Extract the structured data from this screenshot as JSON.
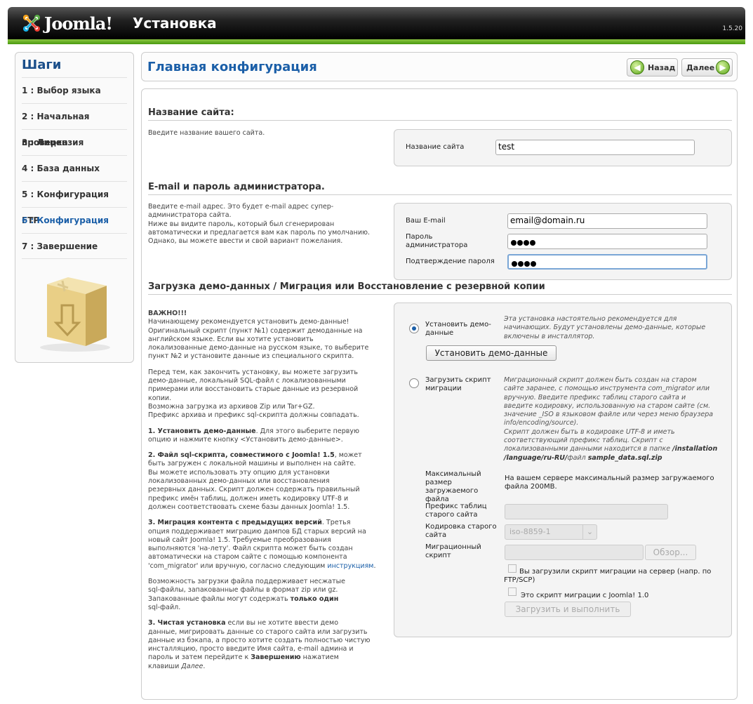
{
  "header": {
    "logo_text": "Joomla!",
    "title": "Установка",
    "version": "1.5.20"
  },
  "steps": {
    "title": "Шаги",
    "items": [
      {
        "label": "1 : Выбор языка"
      },
      {
        "label": "2 : Начальная проверка"
      },
      {
        "label": "3 : Лицензия"
      },
      {
        "label": "4 : База данных"
      },
      {
        "label": "5 : Конфигурация FTP"
      },
      {
        "label": "6 : Конфигурация"
      },
      {
        "label": "7 : Завершение"
      }
    ]
  },
  "page": {
    "title": "Главная конфигурация",
    "back": "Назад",
    "next": "Далее"
  },
  "site": {
    "section_title": "Название сайта:",
    "description": "Введите название вашего сайта.",
    "label": "Название сайта",
    "value": "test"
  },
  "admin": {
    "section_title": "E-mail и пароль администратора.",
    "description": [
      "Введите e-mail адрес. Это будет e-mail адрес супер-",
      "администратора сайта.",
      "Ниже вы видите пароль, который был сгенерирован",
      "автоматически и предлагается вам как пароль по умолчанию.",
      "Однако, вы можете ввести и свой вариант пожелания."
    ],
    "email_label": "Ваш E-mail",
    "email_value": "email@domain.ru",
    "pass_label": "Пароль администратора",
    "pass2_label": "Подтверждение пароля"
  },
  "demo": {
    "section_title": "Загрузка демо-данных / Миграция или Восстановление с резервной копии",
    "important": "ВАЖНО!!!",
    "p1": [
      "Начинающему рекомендуется установить демо-данные!",
      "Оригинальный скрипт (пункт №1) содержит демоданные на",
      "английском языке. Если вы хотите установить",
      "локализованные демо-данные на русском языке, то выберите",
      "пункт №2 и установите данные из специального скрипта."
    ],
    "p2": [
      "Перед тем, как закончить установку, вы можете загрузить",
      "демо-данные, локальный SQL-файл с локализованными",
      "примерами или восстановить старые данные из резервной",
      "копии.",
      "Возможна загрузка из архивов Zip или Tar+GZ.",
      "Префикс архива и префикс sql-скрипта должны совпадать."
    ],
    "p3_bold": "1. Установить демо-данные",
    "p3": [
      ". Для этого выберите первую",
      "опцию и нажмите кнопку <Установить демо-данные>."
    ],
    "p4_bold": "2. Файл sql-скрипта, совместимого с Joomla! 1.5",
    "p4": [
      ", может",
      "быть загружен с локальной машины и выполнен на сайте.",
      "Вы можете использовать эту опцию для установки",
      "локализованных демо-данных или восстановления",
      "резервных данных. Скрипт должен содержать правильный",
      "префикс имён таблиц, должен иметь кодировку UTF-8 и",
      "должен соответствовать схеме базы данных Joomla! 1.5."
    ],
    "p5_bold": "3. Миграция контента с предыдущих версий",
    "p5": [
      ". Третья",
      "опция поддерживает миграцию дампов БД старых версий на",
      "новый сайт Joomla! 1.5. Требуемые преобразования",
      "выполняются 'на-лету'. Файл скрипта может быть создан",
      "автоматически на старом сайте с помощью компонента",
      "'com_migrator' или вручную, согласно следующим"
    ],
    "p5_link": "инструкциям",
    "p6": [
      "Возможность загрузки файла поддерживает несжатые",
      "sql-файлы, запакованные файлы в формат zip или gz.",
      "Запакованные файлы могут содержать "
    ],
    "p6_bold": "только один",
    "p6_end": "sql-файл.",
    "p7_bold": "3. Чистая установка",
    "p7": [
      " если вы не хотите ввести демо",
      "данные, мигрировать данные со старого сайта или загрузить",
      "данные из бэкапа, а просто хотите создать полностью чистую",
      "инсталляцию, просто введите Имя сайта, e-mail админа и",
      "пароль и затем перейдите к "
    ],
    "p7_bold2": "Завершению",
    "p7_mid": " нажатием",
    "p7_end": "клавиши ",
    "p7_italic": "Далее",
    "opt1_label": "Установить демо-данные",
    "opt1_desc": [
      "Эта установка настоятельно рекомендуется для",
      "начинающих. Будут установлены демо-данные, которые",
      "включены в инсталлятор."
    ],
    "opt1_button": "Установить демо-данные",
    "opt2_label": "Загрузить скрипт миграции",
    "opt2_desc": [
      "Миграционный скрипт должен быть создан на старом",
      "сайте заранее, с помощью инструмента com_migrator или",
      "вручную. Введите префикс таблиц старого сайта и",
      "введите кодировку, использованную на старом сайте (см.",
      "значение _ISO в языковом файле или через меню браузера",
      "info/encoding/source).",
      "Скрипт должен быть в кодировке UTF-8 и иметь",
      "соответствующий префикс таблиц. Скрипт с",
      "локализованными данными находится в папке "
    ],
    "opt2_path": "/installation",
    "opt2_path2": "/language/ru-RU/",
    "opt2_file_pre": "файл ",
    "opt2_file": "sample_data.sql.zip",
    "max_label": "Максимальный размер загружаемого файла",
    "max_value": "На вашем сервере максимальный размер загружаемого файла 200MB.",
    "prefix_label": "Префикс таблиц старого сайта",
    "encoding_label": "Кодировка старого сайта",
    "encoding_value": "iso-8859-1",
    "script_label": "Миграционный скрипт",
    "browse": "Обзор...",
    "chk1": "Вы загрузили скрипт миграции на сервер (напр. по FTP/SCP)",
    "chk2": "Это скрипт миграции с Joomla! 1.0",
    "upload_btn": "Загрузить и выполнить"
  }
}
